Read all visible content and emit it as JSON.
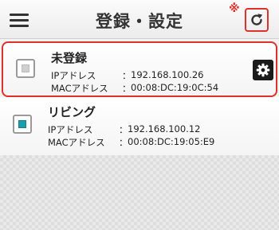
{
  "header": {
    "title": "登録・設定",
    "note_mark": "※",
    "menu_icon": "hamburger-menu-icon",
    "refresh_icon": "refresh-icon"
  },
  "devices": [
    {
      "name": "未登録",
      "ip_label": "IPアドレス",
      "ip_value": "192.168.100.26",
      "mac_label": "MACアドレス",
      "mac_value": "00:08:DC:19:0C:54",
      "icon": "device-inactive-icon",
      "settings_icon": "gear-icon",
      "selected": true
    },
    {
      "name": "リビング",
      "ip_label": "IPアドレス",
      "ip_value": "192.168.100.12",
      "mac_label": "MACアドレス",
      "mac_value": "00:08:DC:19:05:E9",
      "icon": "device-active-icon",
      "selected": false
    }
  ],
  "colors": {
    "highlight": "#e0302a",
    "active_device": "#1a9fa8"
  }
}
